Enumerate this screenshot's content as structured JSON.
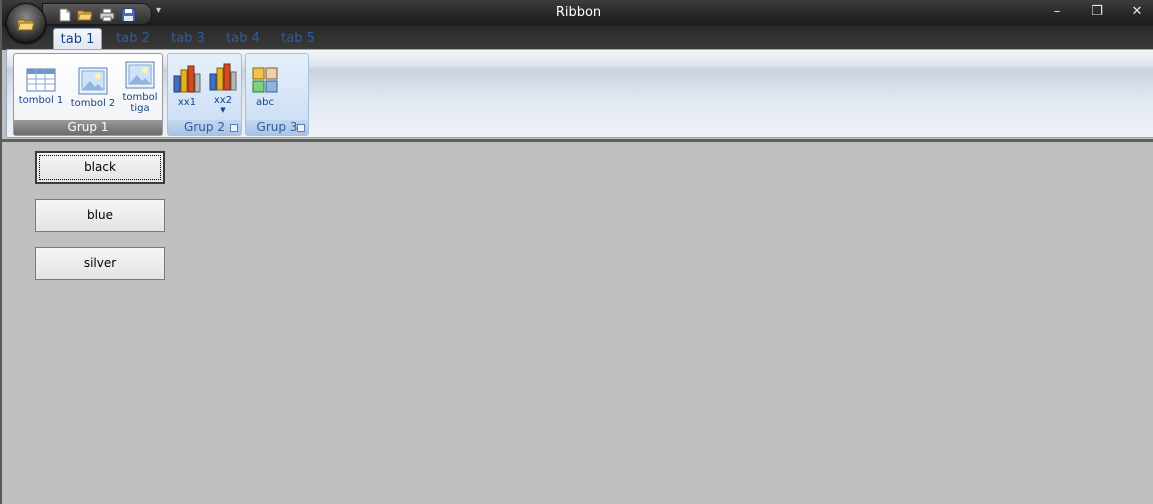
{
  "window": {
    "title": "Ribbon",
    "controls": {
      "minimize": "–",
      "restore": "❐",
      "close": "✕"
    }
  },
  "qat": {
    "menu_glyph": "▾"
  },
  "tabs": [
    {
      "label": "tab 1",
      "active": true
    },
    {
      "label": "tab 2",
      "active": false
    },
    {
      "label": "tab 3",
      "active": false
    },
    {
      "label": "tab 4",
      "active": false
    },
    {
      "label": "tab 5",
      "active": false
    }
  ],
  "ribbon": {
    "groups": [
      {
        "label": "Grup 1",
        "buttons": [
          {
            "label": "tombol 1",
            "icon": "table-icon"
          },
          {
            "label": "tombol 2",
            "icon": "picture-icon"
          },
          {
            "label_lines": [
              "tombol",
              "tiga"
            ],
            "icon": "picture-icon"
          }
        ]
      },
      {
        "label": "Grup 2",
        "buttons": [
          {
            "label": "xx1",
            "icon": "bar-chart-icon"
          },
          {
            "label": "xx2",
            "icon": "bar-chart-icon",
            "dropdown": true
          }
        ]
      },
      {
        "label": "Grup 3",
        "buttons": [
          {
            "label": "abc",
            "icon": "image-grid-icon"
          }
        ]
      }
    ]
  },
  "content": {
    "buttons": [
      {
        "label": "black",
        "focused": true
      },
      {
        "label": "blue",
        "focused": false
      },
      {
        "label": "silver",
        "focused": false
      }
    ]
  },
  "colors": {
    "accent": "#15428b",
    "background": "#bfbfbf",
    "titlebar": "#262626"
  }
}
